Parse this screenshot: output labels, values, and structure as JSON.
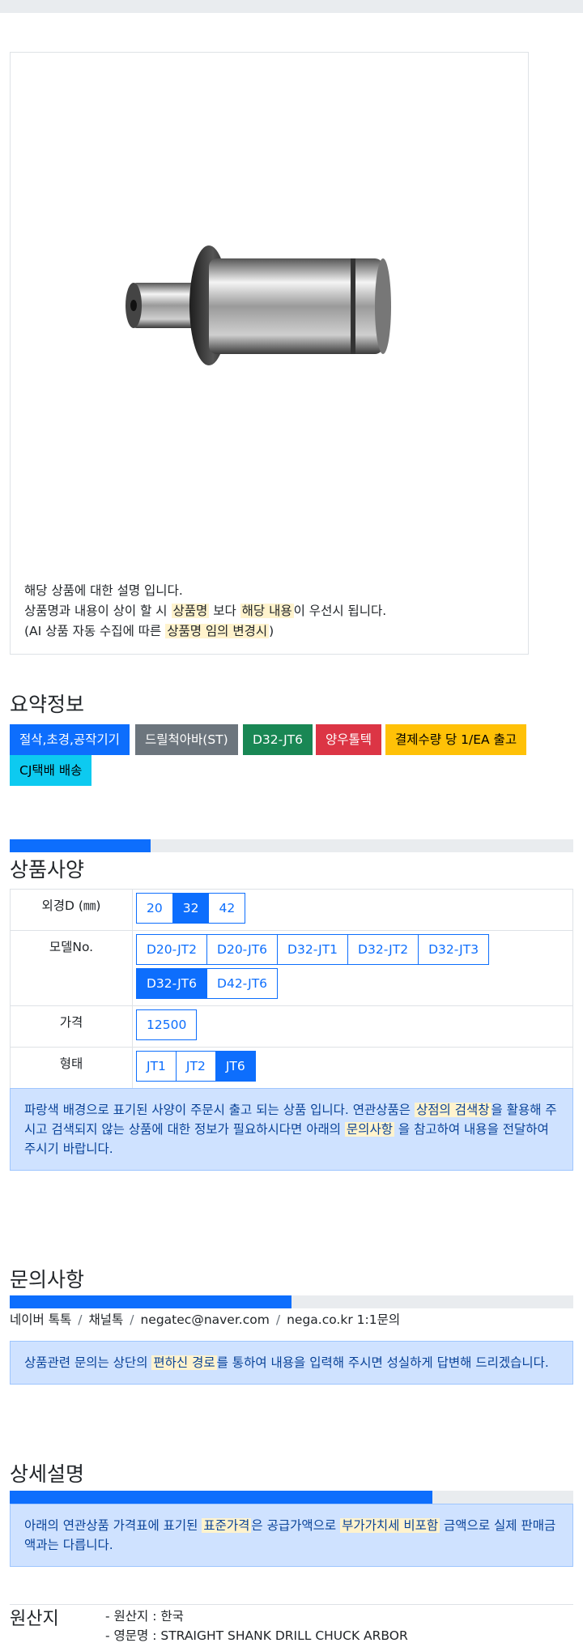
{
  "description": {
    "line1": "해당 상품에 대한 설명 입니다.",
    "line2_pre": "상품명과 내용이 상이 할 시 ",
    "line2_mark1": "상품명",
    "line2_mid": " 보다 ",
    "line2_mark2": "해당 내용",
    "line2_post": "이 우선시 됩니다.",
    "line3_pre": "(AI 상품 자동 수집에 따른 ",
    "line3_mark": "상품명 임의 변경시",
    "line3_post": ")"
  },
  "summary": {
    "title": "요약정보",
    "badges": [
      {
        "label": "절삭,초경,공작기기",
        "color": "#0d6efd"
      },
      {
        "label": "드릴척아바(ST)",
        "color": "#6c757d"
      },
      {
        "label": "D32-JT6",
        "color": "#198754"
      },
      {
        "label": "양우톨텍",
        "color": "#dc3545"
      },
      {
        "label": "결제수량 당 1/EA 출고",
        "color": "#ffc107"
      },
      {
        "label": "CJ택배 배송",
        "color": "#0dcaf0"
      }
    ]
  },
  "spec": {
    "progress_fraction": 0.25,
    "title": "상품사양",
    "rows": [
      {
        "label": "외경D (㎜)",
        "options": [
          "20",
          "32",
          "42"
        ],
        "selected": "32"
      },
      {
        "label": "모델No.",
        "options": [
          "D20-JT2",
          "D20-JT6",
          "D32-JT1",
          "D32-JT2",
          "D32-JT3",
          "D32-JT6",
          "D42-JT6"
        ],
        "selected": "D32-JT6"
      },
      {
        "label": "가격",
        "options": [
          "12500"
        ],
        "selected": ""
      },
      {
        "label": "형태",
        "options": [
          "JT1",
          "JT2",
          "JT6"
        ],
        "selected": "JT6"
      }
    ],
    "notice_pre": "파랑색 배경으로 표기된 사양이 주문시 출고 되는 상품 입니다. 연관상품은 ",
    "notice_mark1": "상점의 검색창",
    "notice_mid": "을 활용해 주시고 검색되지 않는 상품에 대한 정보가 필요하시다면 아래의 ",
    "notice_mark2": "문의사항",
    "notice_post": " 을 참고하여 내용을 전달하여 주시기 바랍니다."
  },
  "inquiry": {
    "title": "문의사항",
    "progress_fraction": 0.5,
    "links": [
      "네이버 톡톡",
      "채널톡",
      "negatec@naver.com",
      "nega.co.kr 1:1문의"
    ],
    "link_separator": "/",
    "notice_pre": "상품관련 문의는 상단의 ",
    "notice_mark": "편하신 경로",
    "notice_post": "를 통하여 내용을 입력해 주시면 성실하게 답변해 드리겠습니다."
  },
  "detail": {
    "title": "상세설명",
    "progress_fraction": 0.75,
    "notice_pre": "아래의 연관상품 가격표에 표기된 ",
    "notice_mark1": "표준가격",
    "notice_mid": "은 공급가액으로 ",
    "notice_mark2": "부가가치세 비포함",
    "notice_post": " 금액으로 실제 판매금액과는 다릅니다."
  },
  "origin": {
    "title": "원산지",
    "items": [
      "- 원산지 : 한국",
      "- 영문명 : STRAIGHT SHANK DRILL CHUCK ARBOR"
    ]
  }
}
